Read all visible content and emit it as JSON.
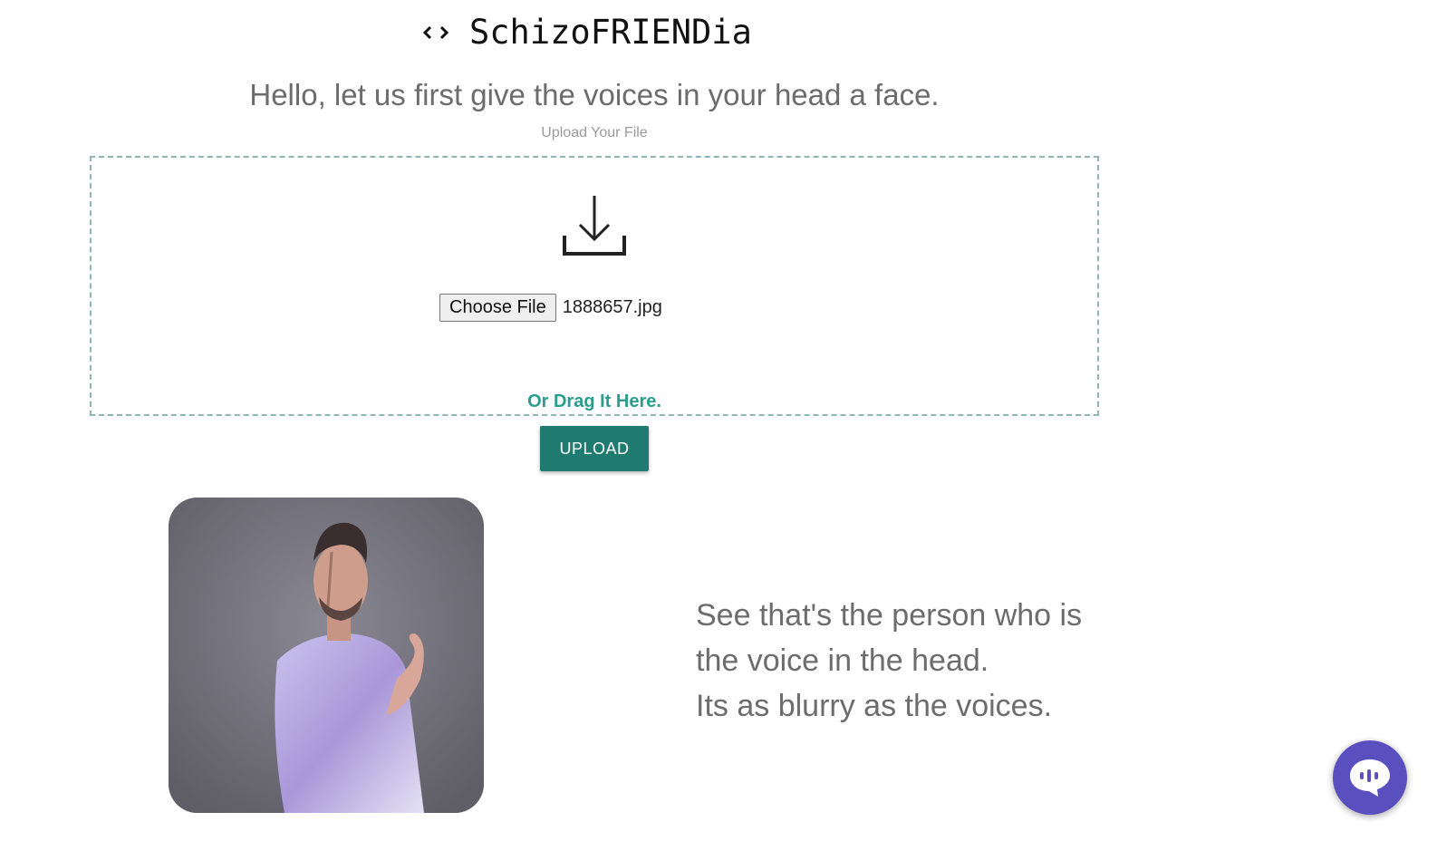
{
  "header": {
    "icon": "code-brackets-icon",
    "title": "SchizoFRIENDia"
  },
  "greeting": "Hello, let us first give the voices in your head a face.",
  "upload": {
    "caption": "Upload Your File",
    "icon": "download-icon",
    "choose_label": "Choose File",
    "file_name": "1888657.jpg",
    "drag_hint": "Or Drag It Here.",
    "submit_label": "UPLOAD"
  },
  "result": {
    "lines": [
      "See that's the person who is",
      "the voice in the head.",
      "Its as blurry as the voices."
    ]
  },
  "chat": {
    "icon": "chat-bubble-icon"
  },
  "colors": {
    "accent": "#1f7a70",
    "drag_text": "#2a9d8f",
    "chat_fab": "#5a4fbf",
    "dropzone_border": "#8fb5b4"
  }
}
